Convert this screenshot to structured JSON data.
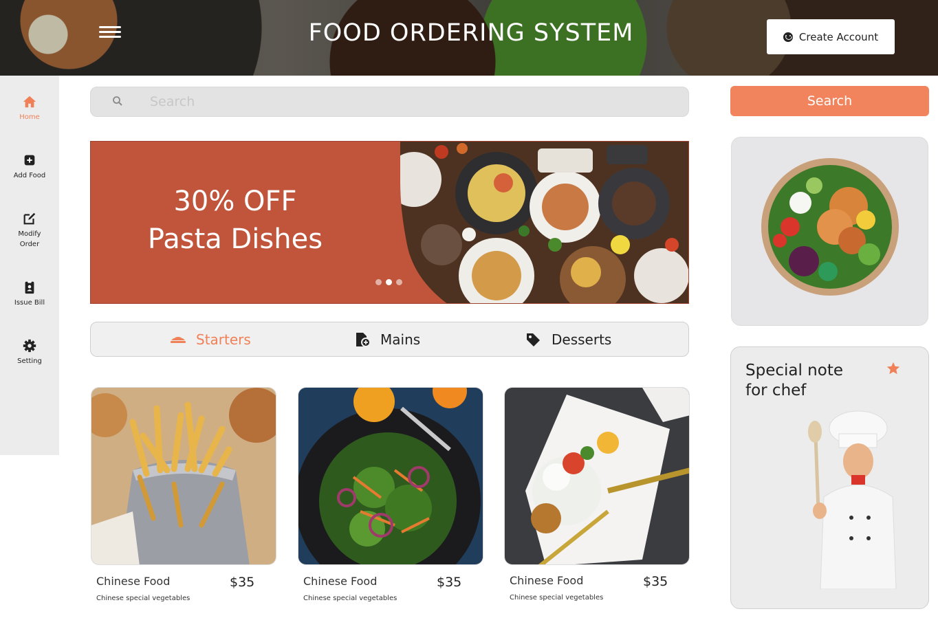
{
  "header": {
    "title": "FOOD ORDERING SYSTEM",
    "create_account_label": "Create Account"
  },
  "sidebar": {
    "items": [
      {
        "label": "Home",
        "icon": "home-icon",
        "active": true
      },
      {
        "label": "Add Food",
        "icon": "plus-square-icon"
      },
      {
        "label": "Modify Order",
        "icon": "edit-icon"
      },
      {
        "label": "Issue Bill",
        "icon": "clipboard-user-icon"
      },
      {
        "label": "Setting",
        "icon": "gear-icon"
      }
    ]
  },
  "search": {
    "placeholder": "Search",
    "value": "",
    "button_label": "Search"
  },
  "banner": {
    "line1": "30% OFF",
    "line2": "Pasta Dishes",
    "active_slide": 2,
    "slide_count": 3
  },
  "tabs": [
    {
      "label": "Starters",
      "icon": "food-tray-icon",
      "active": true
    },
    {
      "label": "Mains",
      "icon": "file-plus-icon"
    },
    {
      "label": "Desserts",
      "icon": "tag-icon"
    }
  ],
  "foods": [
    {
      "name": "Chinese Food",
      "price": "$35",
      "description": "Chinese special vegetables",
      "image": "fries-image"
    },
    {
      "name": "Chinese Food",
      "price": "$35",
      "description": "Chinese special vegetables",
      "image": "salad-bowl-image"
    },
    {
      "name": "Chinese Food",
      "price": "$35",
      "description": "Chinese special vegetables",
      "image": "burrata-plate-image"
    }
  ],
  "chef_note": {
    "title": "Special note for chef"
  },
  "colors": {
    "accent": "#F2845D",
    "banner": "#C0553B",
    "sidebar_bg": "#ECECEC"
  }
}
